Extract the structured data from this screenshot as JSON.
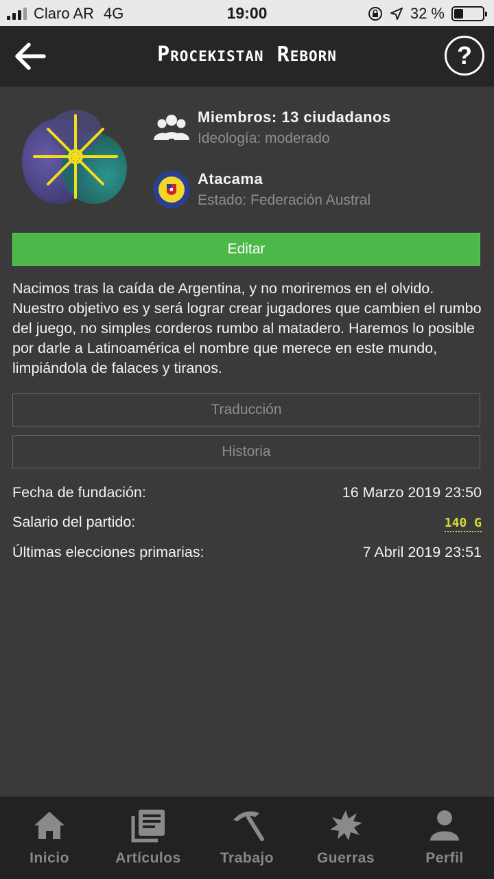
{
  "status_bar": {
    "carrier": "Claro AR",
    "network": "4G",
    "time": "19:00",
    "battery": "32 %",
    "battery_level": 0.32
  },
  "header": {
    "title": "Procekistan Reborn",
    "back_icon": "arrow-left-icon",
    "help_label": "?"
  },
  "party": {
    "members": "Miembros: 13 ciudadanos",
    "ideology": "Ideología: moderado",
    "region": "Atacama",
    "state": "Estado: Federación Austral"
  },
  "actions": {
    "edit_label": "Editar",
    "translation_label": "Traducción",
    "history_label": "Historia"
  },
  "description": "Nacimos tras la caída de Argentina, y no moriremos en el olvido. Nuestro objetivo es y será lograr crear jugadores que cambien el rumbo del juego, no simples corderos rumbo al matadero. Haremos lo posible por darle a Latinoamérica el nombre que merece en este mundo, limpiándola de falaces y tiranos.",
  "details": {
    "founded_label": "Fecha de fundación:",
    "founded_value": "16 Marzo 2019 23:50",
    "salary_label": "Salario del partido:",
    "salary_value": "140 G",
    "primaries_label": "Últimas elecciones primarias:",
    "primaries_value": "7 Abril 2019 23:51"
  },
  "tabs": [
    {
      "label": "Inicio",
      "icon": "home-icon"
    },
    {
      "label": "Artículos",
      "icon": "articles-icon"
    },
    {
      "label": "Trabajo",
      "icon": "pickaxe-icon"
    },
    {
      "label": "Guerras",
      "icon": "explosion-icon"
    },
    {
      "label": "Perfil",
      "icon": "person-icon"
    }
  ],
  "colors": {
    "background": "#3a3a3a",
    "header": "#262626",
    "accent_green": "#4db84a",
    "gold": "#d9d93c",
    "tab_bar": "#222222"
  }
}
